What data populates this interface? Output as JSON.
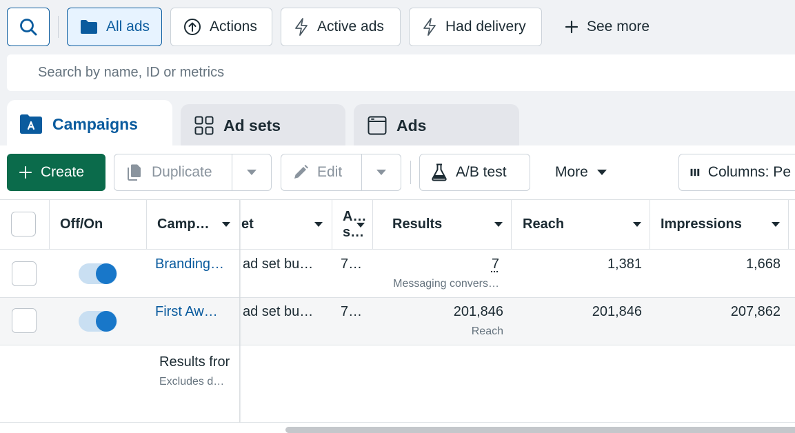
{
  "filter_bar": {
    "search_icon": "search-icon",
    "buttons": [
      {
        "label": "All ads",
        "icon": "folder-icon",
        "active": true
      },
      {
        "label": "Actions",
        "icon": "arrow-up-circle-icon"
      },
      {
        "label": "Active ads",
        "icon": "lightning-icon"
      },
      {
        "label": "Had delivery",
        "icon": "lightning-icon"
      },
      {
        "label": "See more",
        "icon": "plus-icon"
      }
    ]
  },
  "search": {
    "placeholder": "Search by name, ID or metrics",
    "value": ""
  },
  "tabs": [
    {
      "label": "Campaigns",
      "icon": "campaign-folder-icon",
      "active": true
    },
    {
      "label": "Ad sets",
      "icon": "grid-icon"
    },
    {
      "label": "Ads",
      "icon": "ad-window-icon"
    }
  ],
  "toolbar": {
    "create": "Create",
    "duplicate": "Duplicate",
    "edit": "Edit",
    "ab_test": "A/B test",
    "more": "More",
    "columns": "Columns: Pe"
  },
  "table": {
    "headers": {
      "offon": "Off/On",
      "campaign": "Camp…",
      "bid": "et",
      "attr_line1": "A…",
      "attr_line2": "s…",
      "results": "Results",
      "reach": "Reach",
      "impressions": "Impressions"
    },
    "rows": [
      {
        "name": "Branding…",
        "bid": "ad set bu…",
        "attr": "7…",
        "results": "7",
        "results_sub": "Messaging convers…",
        "reach": "1,381",
        "impressions": "1,668",
        "enabled": true
      },
      {
        "name": "First Aw…",
        "bid": "ad set bu…",
        "attr": "7…",
        "results": "201,846",
        "results_sub": "Reach",
        "reach": "201,846",
        "impressions": "207,862",
        "enabled": true
      }
    ],
    "footer": {
      "title": "Results fror",
      "subtitle": "Excludes d…"
    }
  },
  "colors": {
    "brand_blue": "#0a5b9e",
    "create_green": "#0b6b4b",
    "toggle_on": "#1877c9"
  }
}
